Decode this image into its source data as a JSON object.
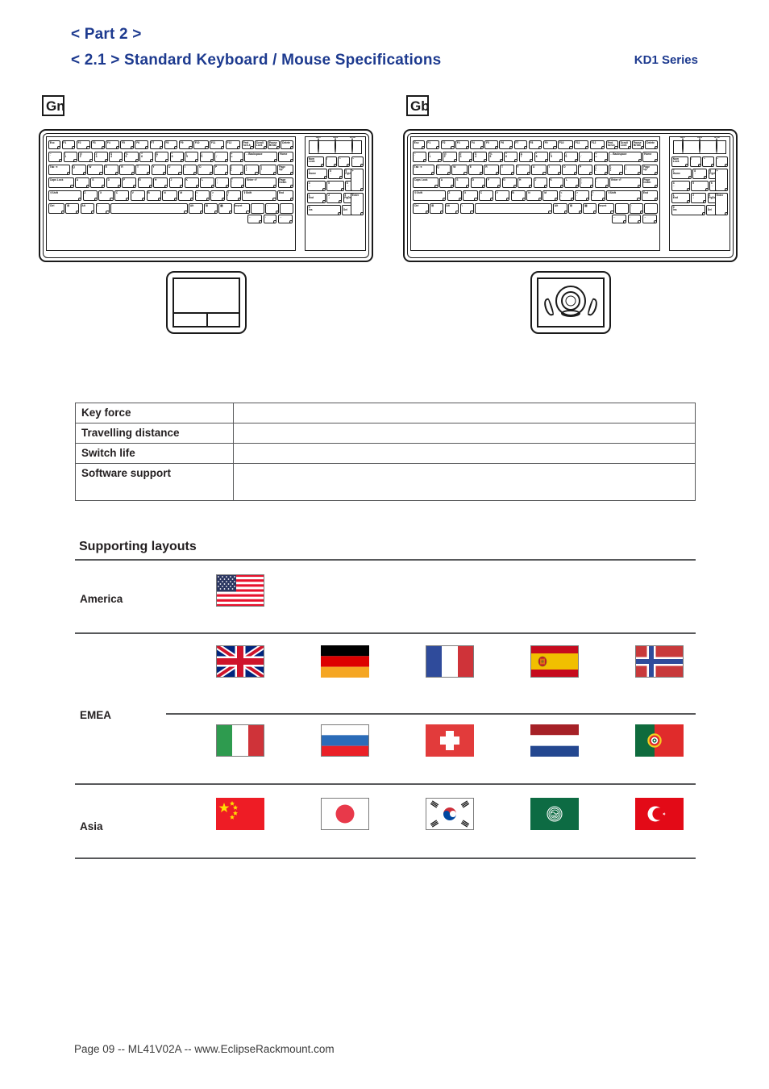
{
  "header": {
    "part": "< Part 2 >",
    "title": "< 2.1 > Standard Keyboard  /  Mouse Specifications",
    "series": "KD1 Series"
  },
  "devices": [
    {
      "tag": "Gn",
      "keyboard_icon": "keyboard-diagram",
      "pointing_device": "touchpad",
      "pointing_device_icon": "touchpad-icon"
    },
    {
      "tag": "Gb",
      "keyboard_icon": "keyboard-diagram",
      "pointing_device": "trackball",
      "pointing_device_icon": "trackball-icon"
    }
  ],
  "keyboard": {
    "leds": [
      "Num Lock",
      "Caps Lock",
      "Scroll Lock"
    ],
    "rows": [
      [
        "Esc",
        "F1",
        "F2",
        "F3",
        "F4",
        "F5",
        "F6",
        "F7",
        "F8",
        "F9",
        "F10",
        "F11",
        "F12",
        "Print Screen",
        "Scroll Lock",
        "Pause Break",
        "Delete"
      ],
      [
        "~ `",
        "! 1",
        "@ 2",
        "# 3",
        "$ 4",
        "% 5",
        "^ 6",
        "& 7",
        "* 8",
        "( 9",
        ") 0",
        "_ -",
        "+ =",
        "← Backspace",
        "Home"
      ],
      [
        "Tab",
        "Q",
        "W",
        "E",
        "R",
        "T",
        "Y",
        "U",
        "I",
        "O",
        "P",
        "{ [",
        "} ]",
        "| \\",
        "Page Up"
      ],
      [
        "Caps Lock",
        "A",
        "S",
        "D",
        "F",
        "G",
        "H",
        "J",
        "K",
        "L",
        ": ;",
        "\" '",
        "Enter ↵",
        "Page Down"
      ],
      [
        "Shift",
        "Z",
        "X",
        "C",
        "V",
        "B",
        "N",
        "M",
        "< ,",
        "> .",
        "? /",
        "Shift",
        "End"
      ],
      [
        "Ctrl",
        "Win",
        "Alt",
        "\\",
        "Space",
        "Alt",
        "Win",
        "Menu",
        "Insert",
        "↑",
        "←",
        "↓",
        "→"
      ]
    ],
    "numpad_rows": [
      [
        "Num Lock",
        "/",
        "*",
        "-"
      ],
      [
        "7 Home",
        "8 ↑",
        "9 PgUp",
        "+"
      ],
      [
        "4 ←",
        "5",
        "6 →"
      ],
      [
        "1 End",
        "2 ↓",
        "3 PgDn",
        "Enter"
      ],
      [
        "0 Ins",
        ". Del"
      ]
    ]
  },
  "spec_table": {
    "rows": [
      {
        "label": "Key force",
        "value": ""
      },
      {
        "label": "Travelling distance",
        "value": ""
      },
      {
        "label": "Switch life",
        "value": ""
      },
      {
        "label": "Software support",
        "value": ""
      }
    ]
  },
  "supporting_layouts": {
    "title": "Supporting layouts",
    "regions": [
      {
        "name": "America",
        "flag_rows": [
          [
            {
              "country": "United States",
              "icon": "flag-us"
            }
          ]
        ]
      },
      {
        "name": "EMEA",
        "flag_rows": [
          [
            {
              "country": "United Kingdom",
              "icon": "flag-gb"
            },
            {
              "country": "Germany",
              "icon": "flag-de"
            },
            {
              "country": "France",
              "icon": "flag-fr"
            },
            {
              "country": "Spain",
              "icon": "flag-es"
            },
            {
              "country": "Norway",
              "icon": "flag-no"
            }
          ],
          [
            {
              "country": "Italy",
              "icon": "flag-it"
            },
            {
              "country": "Russia",
              "icon": "flag-ru"
            },
            {
              "country": "Switzerland",
              "icon": "flag-ch"
            },
            {
              "country": "Netherlands",
              "icon": "flag-nl"
            },
            {
              "country": "Portugal",
              "icon": "flag-pt"
            }
          ]
        ]
      },
      {
        "name": "Asia",
        "flag_rows": [
          [
            {
              "country": "China",
              "icon": "flag-cn"
            },
            {
              "country": "Japan",
              "icon": "flag-jp"
            },
            {
              "country": "South Korea",
              "icon": "flag-kr"
            },
            {
              "country": "Arab League",
              "icon": "flag-arab"
            },
            {
              "country": "Turkey",
              "icon": "flag-tr"
            }
          ]
        ]
      }
    ]
  },
  "footer": {
    "text": "Page 09 -- ML41V02A -- www.EclipseRackmount.com"
  },
  "colors": {
    "heading_blue": "#1d3a8f",
    "rule_gray": "#58595b",
    "ink": "#231f20"
  }
}
